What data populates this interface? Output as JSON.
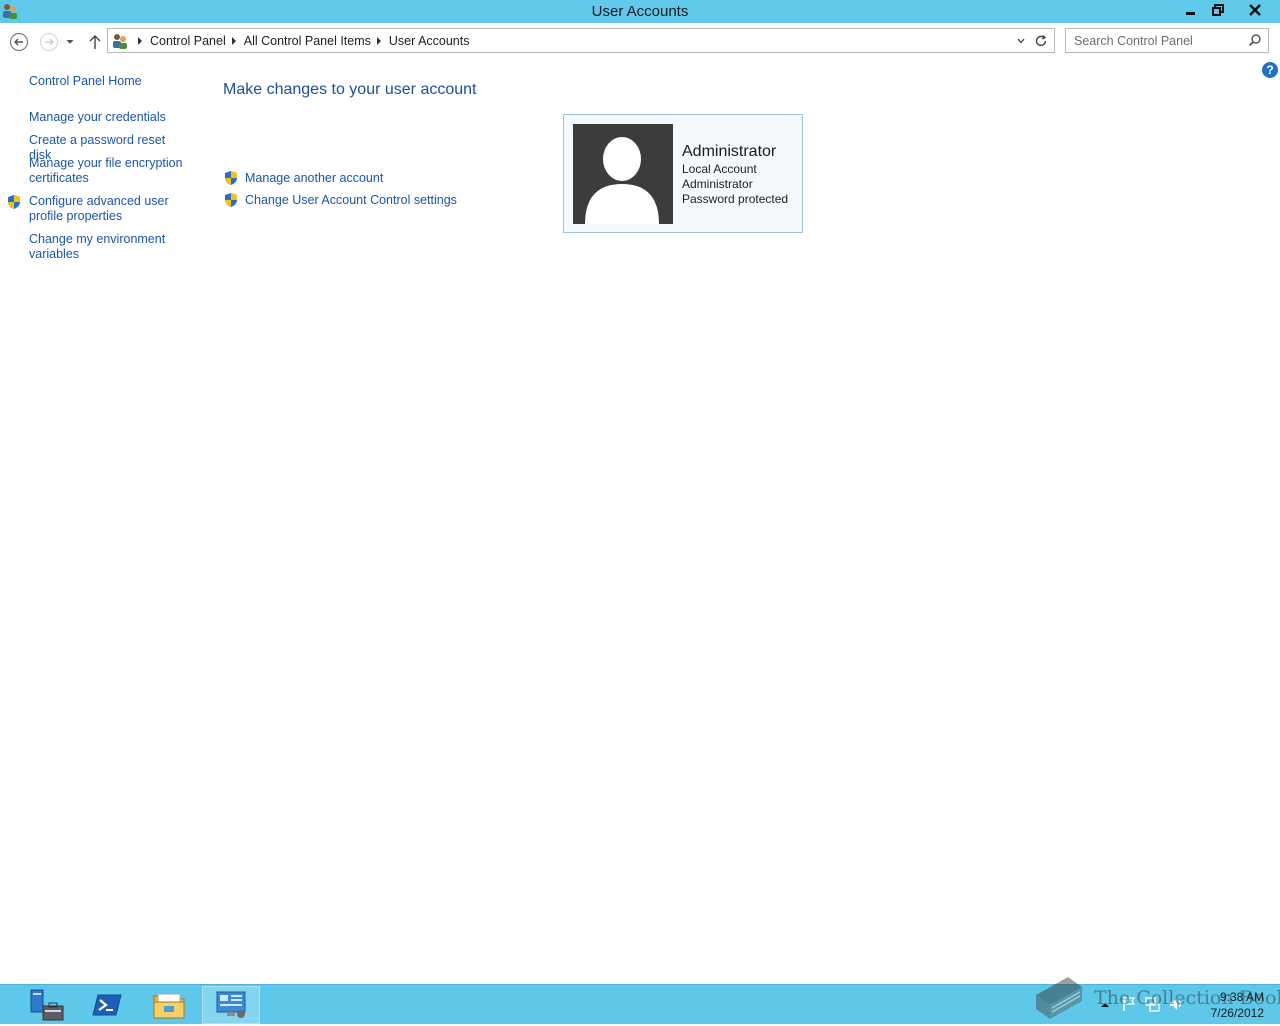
{
  "window": {
    "title": "User Accounts",
    "buttons": {
      "minimize": "minimize",
      "maximize": "restore",
      "close": "close"
    }
  },
  "address_bar": {
    "crumbs": [
      "Control Panel",
      "All Control Panel Items",
      "User Accounts"
    ]
  },
  "search": {
    "placeholder": "Search Control Panel"
  },
  "help_label": "?",
  "left_pane": {
    "home": "Control Panel Home",
    "links": [
      "Manage your credentials",
      "Create a password reset disk",
      "Manage your file encryption certificates",
      "Configure advanced user profile properties",
      "Change my environment variables"
    ]
  },
  "main": {
    "heading": "Make changes to your user account",
    "tasks": [
      "Manage another account",
      "Change User Account Control settings"
    ],
    "account": {
      "name": "Administrator",
      "type": "Local Account",
      "role": "Administrator",
      "status": "Password protected"
    }
  },
  "taskbar": {
    "items": [
      "server-manager-icon",
      "powershell-icon",
      "file-explorer-icon",
      "control-panel-icon"
    ],
    "active": "control-panel-icon",
    "time": "9:38 AM",
    "date": "7/26/2012"
  },
  "watermark": "The Collection Book",
  "colors": {
    "titlebar": "#60c9eb",
    "taskbar": "#5dc8ea",
    "link": "#1a56a8",
    "heading": "#1b4f9a"
  }
}
